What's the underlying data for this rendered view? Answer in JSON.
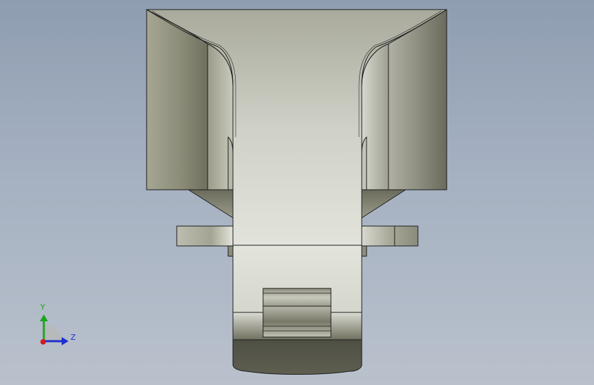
{
  "viewport": {
    "background_top": "#8f9db1",
    "background_bottom": "#b9c1cc",
    "view": "Right"
  },
  "model": {
    "name": "part-front-view",
    "edge_color": "#1b1b1b",
    "face_light": "#d9dbd2",
    "face_dark": "#5e5f52"
  },
  "triad": {
    "y_label": "Y",
    "z_label": "Z",
    "y_color": "#1ea41e",
    "z_color": "#1c2fd2",
    "x_color": "#d21c1c"
  }
}
